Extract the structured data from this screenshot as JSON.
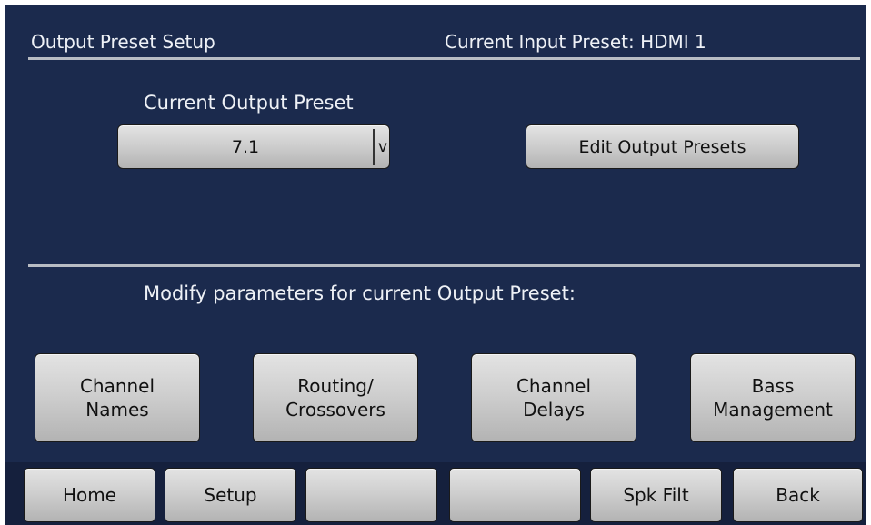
{
  "header": {
    "title": "Output Preset Setup",
    "input_preset": "Current Input Preset: HDMI 1"
  },
  "output_preset": {
    "label": "Current Output Preset",
    "selected": "7.1",
    "dropdown_glyph": "v",
    "edit_button": "Edit Output Presets"
  },
  "modify": {
    "label": "Modify parameters for current Output Preset:",
    "buttons": [
      "Channel\nNames",
      "Routing/\nCrossovers",
      "Channel\nDelays",
      "Bass\nManagement"
    ]
  },
  "nav": {
    "buttons": [
      "Home",
      "Setup",
      "",
      "",
      "Spk Filt",
      "Back"
    ]
  },
  "colors": {
    "background": "#1b2a4d",
    "navbar": "#15203d",
    "button": "#cfcfcf",
    "text": "#eef1f6"
  }
}
